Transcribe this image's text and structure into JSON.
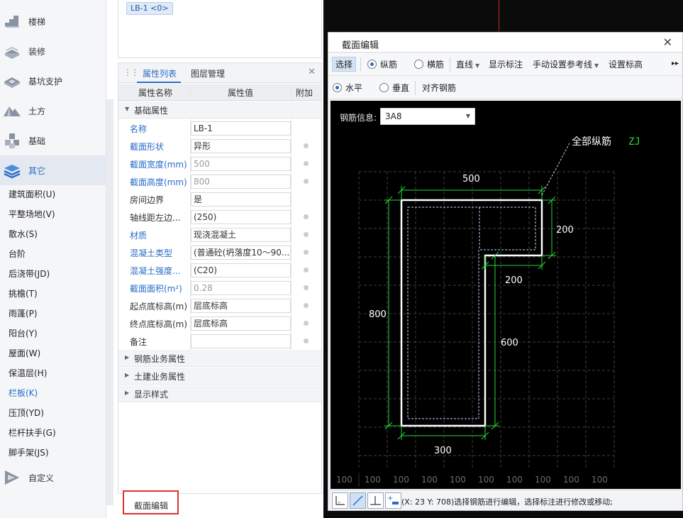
{
  "leftnav": {
    "categories": [
      {
        "label": "楼梯",
        "icon": "stairs-icon"
      },
      {
        "label": "装修",
        "icon": "decoration-icon"
      },
      {
        "label": "基坑支护",
        "icon": "foundation-pit-icon"
      },
      {
        "label": "土方",
        "icon": "earthwork-icon"
      },
      {
        "label": "基础",
        "icon": "foundation-icon"
      },
      {
        "label": "其它",
        "icon": "others-icon"
      }
    ],
    "subitems": [
      "建筑面积(U)",
      "平整场地(V)",
      "散水(S)",
      "台阶",
      "后浇带(JD)",
      "挑檐(T)",
      "雨蓬(P)",
      "阳台(Y)",
      "屋面(W)",
      "保温层(H)",
      "栏板(K)",
      "压顶(YD)",
      "栏杆扶手(G)",
      "脚手架(JS)"
    ],
    "custom": {
      "label": "自定义",
      "icon": "custom-icon"
    }
  },
  "top_panel": {
    "tag": "LB-1 <0>"
  },
  "props": {
    "tabs": [
      "属性列表",
      "图层管理"
    ],
    "headers": [
      "属性名称",
      "属性值",
      "附加"
    ],
    "section_basic": "基础属性",
    "rows": [
      {
        "name": "名称",
        "value": "LB-1"
      },
      {
        "name": "截面形状",
        "value": "异形"
      },
      {
        "name": "截面宽度(mm)",
        "value": "500"
      },
      {
        "name": "截面高度(mm)",
        "value": "800"
      },
      {
        "name": "房间边界",
        "value": "是"
      },
      {
        "name": "轴线距左边...",
        "value": "(250)"
      },
      {
        "name": "材质",
        "value": "现浇混凝土"
      },
      {
        "name": "混凝土类型",
        "value": "(普通砼(坍落度10～90..."
      },
      {
        "name": "混凝土强度...",
        "value": "(C20)"
      },
      {
        "name": "截面面积(m²)",
        "value": "0.28"
      },
      {
        "name": "起点底标高(m)",
        "value": "层底标高"
      },
      {
        "name": "终点底标高(m)",
        "value": "层底标高"
      },
      {
        "name": "备注",
        "value": ""
      }
    ],
    "collapsed_sections": [
      "钢筋业务属性",
      "土建业务属性",
      "显示样式"
    ]
  },
  "bottom_tab": "截面编辑",
  "dialog": {
    "title": "截面编辑",
    "toolbar1": {
      "select": "选择",
      "longitudinal": "纵筋",
      "stirrup": "横筋",
      "line": "直线",
      "show_dim": "显示标注",
      "manual_ref": "手动设置参考线",
      "set_elev": "设置标高"
    },
    "toolbar2": {
      "horizontal": "水平",
      "vertical": "垂直",
      "align": "对齐钢筋"
    },
    "rebar_info_label": "钢筋信息:",
    "rebar_info_value": "3A8",
    "drawing": {
      "all_long_label": "全部纵筋",
      "all_long_code": "ZJ",
      "dims": {
        "top": "500",
        "right_upper": "200",
        "step": "200",
        "left": "800",
        "inner_right": "600",
        "bottom": "300"
      },
      "scale_value": "100"
    },
    "status_text": "(X: 23 Y: 708)选择钢筋进行编辑，选择标注进行修改或移动;"
  },
  "colors": {
    "accent": "#2a6cc7",
    "dim_green": "#27d63a",
    "highlight_red": "#e03030"
  }
}
